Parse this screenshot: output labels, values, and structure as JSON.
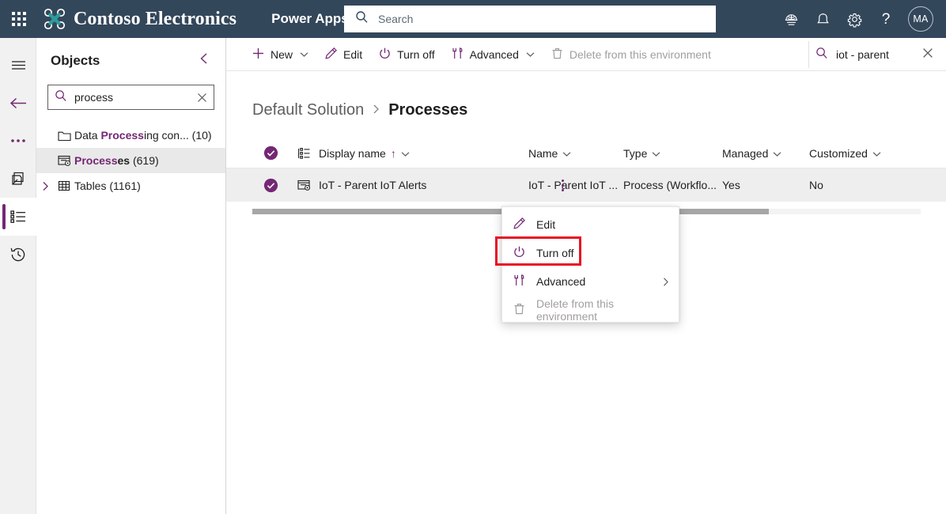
{
  "header": {
    "waffle_icon": "app-launcher-icon",
    "brand_name": "Contoso Electronics",
    "app_name": "Power Apps",
    "search": {
      "placeholder": "Search",
      "icon": "search-icon",
      "value": ""
    },
    "icons": [
      {
        "name": "environment-globe-icon",
        "glyph": "globe"
      },
      {
        "name": "notifications-bell-icon",
        "glyph": "bell"
      },
      {
        "name": "settings-gear-icon",
        "glyph": "gear"
      },
      {
        "name": "help-question-icon",
        "glyph": "?"
      }
    ],
    "avatar_initials": "MA"
  },
  "rail": {
    "items": [
      {
        "name": "hamburger-menu-icon",
        "label": "Menu",
        "selected": false
      },
      {
        "name": "back-arrow-icon",
        "label": "Back",
        "selected": false
      },
      {
        "name": "more-ellipsis-icon",
        "label": "More",
        "selected": false
      },
      {
        "name": "solutions-icon",
        "label": "Solutions",
        "selected": false
      },
      {
        "name": "objects-list-icon",
        "label": "Objects",
        "selected": true
      },
      {
        "name": "recent-history-icon",
        "label": "Recent",
        "selected": false
      }
    ]
  },
  "objects_panel": {
    "title": "Objects",
    "collapse_icon": "chevron-left-icon",
    "search": {
      "icon": "search-icon",
      "value": "process",
      "clear_icon": "close-icon"
    },
    "tree": [
      {
        "icon": "folder-icon",
        "label_pre": "Data ",
        "label_match": "Process",
        "label_post": "ing con...",
        "count": "(10)",
        "expandable": false,
        "selected": false
      },
      {
        "icon": "processes-icon",
        "label_pre": "",
        "label_match": "Process",
        "label_post": "es",
        "count": "(619)",
        "expandable": false,
        "selected": true
      },
      {
        "icon": "table-icon",
        "label_pre": "Tables",
        "label_match": "",
        "label_post": "",
        "count": "(1161)",
        "expandable": true,
        "selected": false
      }
    ]
  },
  "command_bar": {
    "buttons": [
      {
        "label": "New",
        "icon": "plus-icon",
        "has_chevron": true,
        "disabled": false
      },
      {
        "label": "Edit",
        "icon": "pencil-icon",
        "has_chevron": false,
        "disabled": false
      },
      {
        "label": "Turn off",
        "icon": "power-icon",
        "has_chevron": false,
        "disabled": false
      },
      {
        "label": "Advanced",
        "icon": "tools-icon",
        "has_chevron": true,
        "disabled": false
      },
      {
        "label": "Delete from this environment",
        "icon": "trash-icon",
        "has_chevron": false,
        "disabled": true
      }
    ],
    "search": {
      "icon": "search-icon",
      "value": "iot - parent",
      "clear_icon": "close-icon"
    }
  },
  "breadcrumb": {
    "parent": "Default Solution",
    "separator_icon": "chevron-right-icon",
    "current": "Processes"
  },
  "grid": {
    "columns": [
      {
        "key": "check",
        "label": "",
        "icon": "select-all-check-icon",
        "sort": "",
        "has_chevron": false
      },
      {
        "key": "typeicon",
        "label": "",
        "icon": "column-options-icon",
        "sort": "",
        "has_chevron": false
      },
      {
        "key": "display",
        "label": "Display name",
        "icon": "",
        "sort": "↑",
        "has_chevron": true
      },
      {
        "key": "name",
        "label": "Name",
        "icon": "",
        "sort": "",
        "has_chevron": true
      },
      {
        "key": "type",
        "label": "Type",
        "icon": "",
        "sort": "",
        "has_chevron": true
      },
      {
        "key": "managed",
        "label": "Managed",
        "icon": "",
        "sort": "",
        "has_chevron": true
      },
      {
        "key": "customized",
        "label": "Customized",
        "icon": "",
        "sort": "",
        "has_chevron": true
      }
    ],
    "rows": [
      {
        "selected": true,
        "row_icon": "process-row-icon",
        "display": "IoT - Parent IoT Alerts",
        "kebab_icon": "more-vertical-icon",
        "name": "IoT - Parent IoT ...",
        "type": "Process (Workflo...",
        "managed": "Yes",
        "customized": "No"
      }
    ]
  },
  "context_menu": {
    "items": [
      {
        "label": "Edit",
        "icon": "pencil-icon",
        "disabled": false,
        "submenu": false,
        "highlighted": false
      },
      {
        "label": "Turn off",
        "icon": "power-icon",
        "disabled": false,
        "submenu": false,
        "highlighted": true
      },
      {
        "label": "Advanced",
        "icon": "tools-icon",
        "disabled": false,
        "submenu": true,
        "highlighted": false
      },
      {
        "label": "Delete from this environment",
        "icon": "trash-icon",
        "disabled": true,
        "submenu": false,
        "highlighted": false
      }
    ]
  },
  "colors": {
    "header_bg": "#33475B",
    "accent_purple": "#742774",
    "highlight_red": "#E81123",
    "row_selected_bg": "#EEEEEE",
    "teal_logo": "#2E9B9B"
  }
}
